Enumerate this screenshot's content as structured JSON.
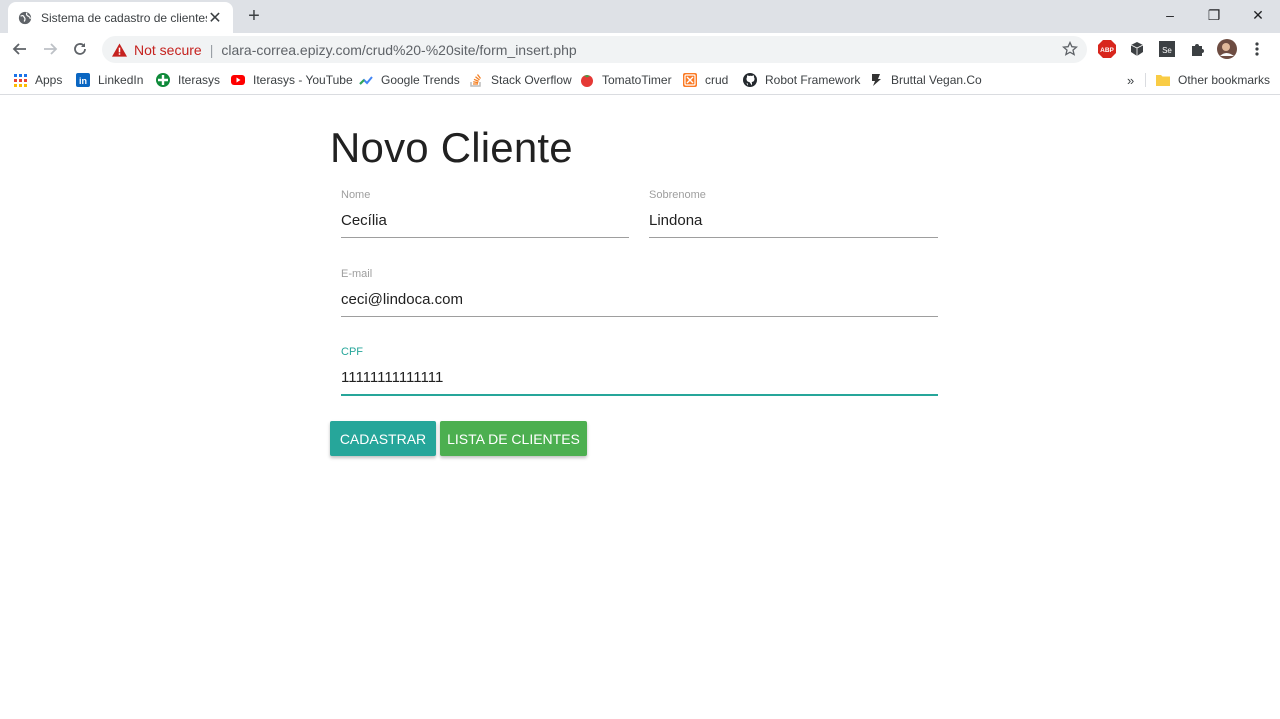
{
  "browser": {
    "tab_title": "Sistema de cadastro de clientes",
    "tab_close": "✕",
    "new_tab": "+",
    "window": {
      "minimize": "–",
      "restore": "❐",
      "close": "✕"
    },
    "security_label": "Not secure",
    "url": "clara-correa.epizy.com/crud%20-%20site/form_insert.php"
  },
  "bookmarks": {
    "items": [
      {
        "label": "Apps",
        "icon": "apps-grid-icon",
        "color": "#1a73e8"
      },
      {
        "label": "LinkedIn",
        "icon": "linkedin-icon",
        "color": "#0a66c2"
      },
      {
        "label": "Iterasys",
        "icon": "iterasys-icon",
        "color": "#0f8a3a"
      },
      {
        "label": "Iterasys - YouTube",
        "icon": "youtube-icon",
        "color": "#ff0000"
      },
      {
        "label": "Google Trends",
        "icon": "trends-icon",
        "color": "#4285f4"
      },
      {
        "label": "Stack Overflow",
        "icon": "stackoverflow-icon",
        "color": "#f48024"
      },
      {
        "label": "TomatoTimer",
        "icon": "tomato-icon",
        "color": "#e53935"
      },
      {
        "label": "crud",
        "icon": "xampp-icon",
        "color": "#fb7a24"
      },
      {
        "label": "Robot Framework",
        "icon": "github-icon",
        "color": "#24292e"
      },
      {
        "label": "Bruttal Vegan.Co",
        "icon": "bruttal-icon",
        "color": "#333333"
      }
    ],
    "overflow": "»",
    "other": "Other bookmarks"
  },
  "page": {
    "title": "Novo Cliente",
    "fields": {
      "nome": {
        "label": "Nome",
        "value": "Cecília"
      },
      "sobrenome": {
        "label": "Sobrenome",
        "value": "Lindona"
      },
      "email": {
        "label": "E-mail",
        "value": "ceci@lindoca.com"
      },
      "cpf": {
        "label": "CPF",
        "value": "11111111111111"
      }
    },
    "buttons": {
      "cadastrar": {
        "label": "CADASTRAR",
        "color": "#26a69a"
      },
      "lista": {
        "label": "LISTA DE CLIENTES",
        "color": "#4caf50"
      }
    },
    "accent_color": "#26a69a"
  }
}
